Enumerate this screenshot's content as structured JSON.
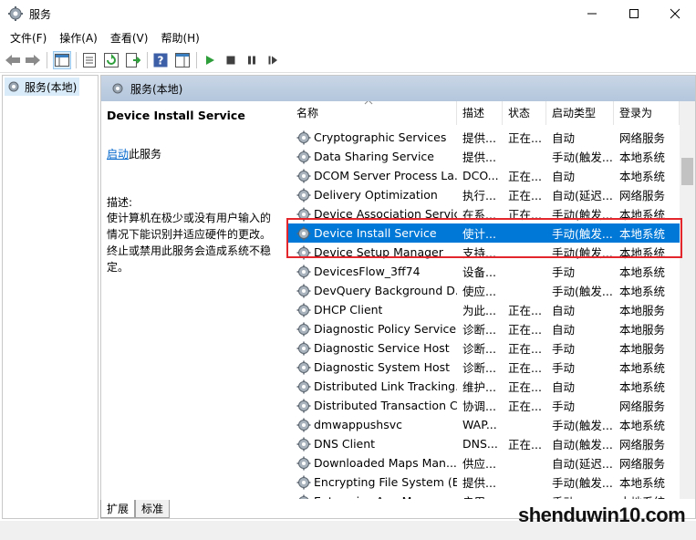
{
  "window": {
    "title": "服务",
    "minimize_icon": "minimize-icon",
    "maximize_icon": "maximize-icon",
    "close_icon": "close-icon"
  },
  "menu": [
    "文件(F)",
    "操作(A)",
    "查看(V)",
    "帮助(H)"
  ],
  "toolbar": {
    "icons": [
      "back-arrow-icon",
      "forward-arrow-icon",
      "console-tree-icon",
      "properties-icon",
      "refresh-icon",
      "export-list-icon",
      "help-icon",
      "show-hide-icon",
      "start-service-icon",
      "stop-service-icon",
      "pause-service-icon",
      "restart-service-icon"
    ]
  },
  "tree": {
    "item_label": "服务(本地)"
  },
  "pane": {
    "header": "服务(本地)"
  },
  "detail": {
    "service_name": "Device Install Service",
    "start_link": "启动",
    "start_suffix": "此服务",
    "desc_label": "描述:",
    "desc_text": "使计算机在极少或没有用户输入的情况下能识别并适应硬件的更改。终止或禁用此服务会造成系统不稳定。"
  },
  "columns": {
    "name": "名称",
    "desc": "描述",
    "status": "状态",
    "startup": "启动类型",
    "logon": "登录为"
  },
  "services": [
    {
      "name": "Cryptographic Services",
      "desc": "提供...",
      "status": "正在...",
      "startup": "自动",
      "logon": "网络服务"
    },
    {
      "name": "Data Sharing Service",
      "desc": "提供...",
      "status": "",
      "startup": "手动(触发...",
      "logon": "本地系统"
    },
    {
      "name": "DCOM Server Process La...",
      "desc": "DCO...",
      "status": "正在...",
      "startup": "自动",
      "logon": "本地系统"
    },
    {
      "name": "Delivery Optimization",
      "desc": "执行...",
      "status": "正在...",
      "startup": "自动(延迟...",
      "logon": "网络服务"
    },
    {
      "name": "Device Association Service",
      "desc": "在系...",
      "status": "正在...",
      "startup": "手动(触发...",
      "logon": "本地系统"
    },
    {
      "name": "Device Install Service",
      "desc": "使计...",
      "status": "",
      "startup": "手动(触发...",
      "logon": "本地系统"
    },
    {
      "name": "Device Setup Manager",
      "desc": "支持...",
      "status": "",
      "startup": "手动(触发...",
      "logon": "本地系统"
    },
    {
      "name": "DevicesFlow_3ff74",
      "desc": "设备...",
      "status": "",
      "startup": "手动",
      "logon": "本地系统"
    },
    {
      "name": "DevQuery Background D...",
      "desc": "使应...",
      "status": "",
      "startup": "手动(触发...",
      "logon": "本地系统"
    },
    {
      "name": "DHCP Client",
      "desc": "为此...",
      "status": "正在...",
      "startup": "自动",
      "logon": "本地服务"
    },
    {
      "name": "Diagnostic Policy Service",
      "desc": "诊断...",
      "status": "正在...",
      "startup": "自动",
      "logon": "本地服务"
    },
    {
      "name": "Diagnostic Service Host",
      "desc": "诊断...",
      "status": "正在...",
      "startup": "手动",
      "logon": "本地服务"
    },
    {
      "name": "Diagnostic System Host",
      "desc": "诊断...",
      "status": "正在...",
      "startup": "手动",
      "logon": "本地系统"
    },
    {
      "name": "Distributed Link Tracking...",
      "desc": "维护...",
      "status": "正在...",
      "startup": "自动",
      "logon": "本地系统"
    },
    {
      "name": "Distributed Transaction C...",
      "desc": "协调...",
      "status": "正在...",
      "startup": "手动",
      "logon": "网络服务"
    },
    {
      "name": "dmwappushsvc",
      "desc": "WAP...",
      "status": "",
      "startup": "手动(触发...",
      "logon": "本地系统"
    },
    {
      "name": "DNS Client",
      "desc": "DNS...",
      "status": "正在...",
      "startup": "自动(触发...",
      "logon": "网络服务"
    },
    {
      "name": "Downloaded Maps Man...",
      "desc": "供应...",
      "status": "",
      "startup": "自动(延迟...",
      "logon": "网络服务"
    },
    {
      "name": "Encrypting File System (E...",
      "desc": "提供...",
      "status": "",
      "startup": "手动(触发...",
      "logon": "本地系统"
    },
    {
      "name": "Enterprise App Manage...",
      "desc": "启用...",
      "status": "",
      "startup": "手动",
      "logon": "本地系统"
    }
  ],
  "selected_index": 5,
  "tabs": [
    "扩展",
    "标准"
  ],
  "watermark": "shenduwin10.com",
  "colors": {
    "selection": "#0078d7",
    "highlight_border": "#e2262b",
    "link": "#0066cc"
  }
}
